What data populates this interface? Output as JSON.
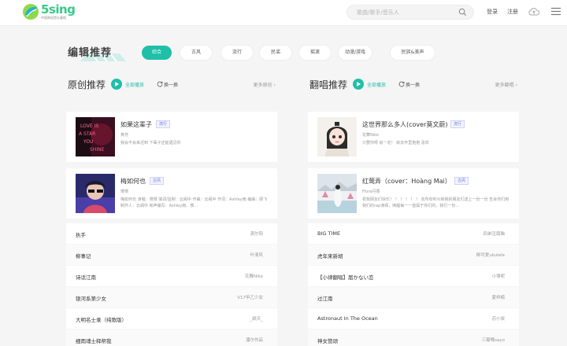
{
  "header": {
    "logo_text": "5sing",
    "logo_sub": "中国原创音乐基地",
    "search_placeholder": "歌曲/歌手/音乐人",
    "login": "登录",
    "register": "注册"
  },
  "editor_picks": {
    "title": "编辑推荐",
    "tabs": [
      "综合",
      "古风",
      "流行",
      "民谣",
      "摇滚",
      "动漫/游戏",
      "民族&美声"
    ],
    "active_tab": "综合"
  },
  "original": {
    "title": "原创推荐",
    "play_all": "全部播放",
    "refresh": "换一换",
    "more": "更多原创",
    "cards": [
      {
        "title": "如果这辈子",
        "tag": "流行",
        "singer": "黄尧",
        "desc": "我会不会来迟到 下辈子还能遇见你"
      },
      {
        "title": "梅如何也",
        "tag": "古风",
        "singer": "慢慢",
        "desc": "梅如何也 演唱：慢慢 填词/监制：云阙中 作曲：云阙中 作词：Ashley雨 编曲：顾飞 制作人：云阙中 和声编写：Ashley雨、慢..."
      }
    ],
    "list": [
      {
        "title": "执手",
        "artist": "潇尔阳"
      },
      {
        "title": "柳事记",
        "artist": "叶清风"
      },
      {
        "title": "诗话江南",
        "artist": "花舞Niko"
      },
      {
        "title": "银河系第少女",
        "artist": "V17甲乙少女"
      },
      {
        "title": "大明名士录（纯歌版）",
        "artist": "_颖天_"
      },
      {
        "title": "细雨魂士释帮我",
        "artist": "潘尔作品"
      }
    ]
  },
  "cover": {
    "title": "翻唱推荐",
    "play_all": "全部播放",
    "refresh": "换一换",
    "more": "更多翻唱",
    "cards": [
      {
        "title": "这世界那么多人(cover莫文蔚)",
        "tag": "流行",
        "singer": "花舞Niko",
        "desc": "只要你呀 就一定！ 就去怀里抱抱 喜欢"
      },
      {
        "title": "红莺弄（cover：Hoàng Mai）",
        "tag": "古风",
        "singer": "Flora丹香",
        "desc": "祝我朋友们快乐！ ！ ！ ！ ！ ！ 向所有听众和我的朋友们送上一份一份 告诉你们用我们的rap演绎，唤醒每一一首属于你们的，我们一份..."
      }
    ],
    "list": [
      {
        "title": "BIG TIME",
        "artist": "四弟豆腐脑"
      },
      {
        "title": "虎年来新胡",
        "artist": "柳可爱ukulele"
      },
      {
        "title": "【小律翻唱】届かない恋",
        "artist": "小律呢"
      },
      {
        "title": "过江南",
        "artist": "夏梓楠"
      },
      {
        "title": "Astronaut In The Ocean",
        "artist": "苏小柒"
      },
      {
        "title": "神女赞颂",
        "artist": "三瓣嘴sayo"
      }
    ]
  },
  "colors": {
    "accent": "#1fbfa8",
    "logo_green": "#35c88a",
    "tag_blue": "#6c79d9"
  }
}
